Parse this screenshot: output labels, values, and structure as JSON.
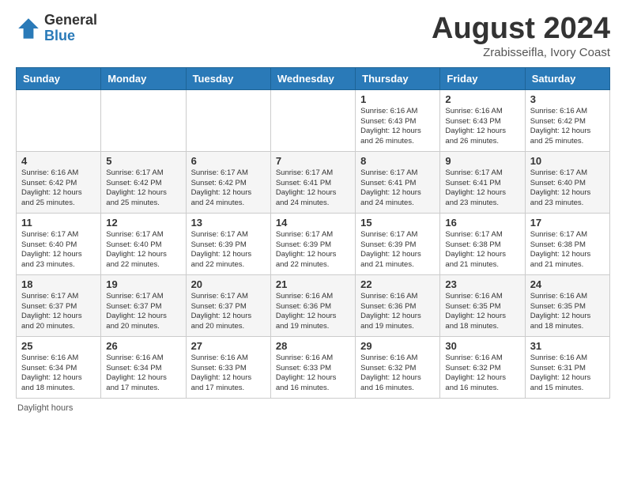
{
  "logo": {
    "general": "General",
    "blue": "Blue"
  },
  "title": "August 2024",
  "subtitle": "Zrabisseifla, Ivory Coast",
  "headers": [
    "Sunday",
    "Monday",
    "Tuesday",
    "Wednesday",
    "Thursday",
    "Friday",
    "Saturday"
  ],
  "footer": "Daylight hours",
  "weeks": [
    [
      {
        "day": "",
        "info": ""
      },
      {
        "day": "",
        "info": ""
      },
      {
        "day": "",
        "info": ""
      },
      {
        "day": "",
        "info": ""
      },
      {
        "day": "1",
        "info": "Sunrise: 6:16 AM\nSunset: 6:43 PM\nDaylight: 12 hours\nand 26 minutes."
      },
      {
        "day": "2",
        "info": "Sunrise: 6:16 AM\nSunset: 6:43 PM\nDaylight: 12 hours\nand 26 minutes."
      },
      {
        "day": "3",
        "info": "Sunrise: 6:16 AM\nSunset: 6:42 PM\nDaylight: 12 hours\nand 25 minutes."
      }
    ],
    [
      {
        "day": "4",
        "info": "Sunrise: 6:16 AM\nSunset: 6:42 PM\nDaylight: 12 hours\nand 25 minutes."
      },
      {
        "day": "5",
        "info": "Sunrise: 6:17 AM\nSunset: 6:42 PM\nDaylight: 12 hours\nand 25 minutes."
      },
      {
        "day": "6",
        "info": "Sunrise: 6:17 AM\nSunset: 6:42 PM\nDaylight: 12 hours\nand 24 minutes."
      },
      {
        "day": "7",
        "info": "Sunrise: 6:17 AM\nSunset: 6:41 PM\nDaylight: 12 hours\nand 24 minutes."
      },
      {
        "day": "8",
        "info": "Sunrise: 6:17 AM\nSunset: 6:41 PM\nDaylight: 12 hours\nand 24 minutes."
      },
      {
        "day": "9",
        "info": "Sunrise: 6:17 AM\nSunset: 6:41 PM\nDaylight: 12 hours\nand 23 minutes."
      },
      {
        "day": "10",
        "info": "Sunrise: 6:17 AM\nSunset: 6:40 PM\nDaylight: 12 hours\nand 23 minutes."
      }
    ],
    [
      {
        "day": "11",
        "info": "Sunrise: 6:17 AM\nSunset: 6:40 PM\nDaylight: 12 hours\nand 23 minutes."
      },
      {
        "day": "12",
        "info": "Sunrise: 6:17 AM\nSunset: 6:40 PM\nDaylight: 12 hours\nand 22 minutes."
      },
      {
        "day": "13",
        "info": "Sunrise: 6:17 AM\nSunset: 6:39 PM\nDaylight: 12 hours\nand 22 minutes."
      },
      {
        "day": "14",
        "info": "Sunrise: 6:17 AM\nSunset: 6:39 PM\nDaylight: 12 hours\nand 22 minutes."
      },
      {
        "day": "15",
        "info": "Sunrise: 6:17 AM\nSunset: 6:39 PM\nDaylight: 12 hours\nand 21 minutes."
      },
      {
        "day": "16",
        "info": "Sunrise: 6:17 AM\nSunset: 6:38 PM\nDaylight: 12 hours\nand 21 minutes."
      },
      {
        "day": "17",
        "info": "Sunrise: 6:17 AM\nSunset: 6:38 PM\nDaylight: 12 hours\nand 21 minutes."
      }
    ],
    [
      {
        "day": "18",
        "info": "Sunrise: 6:17 AM\nSunset: 6:37 PM\nDaylight: 12 hours\nand 20 minutes."
      },
      {
        "day": "19",
        "info": "Sunrise: 6:17 AM\nSunset: 6:37 PM\nDaylight: 12 hours\nand 20 minutes."
      },
      {
        "day": "20",
        "info": "Sunrise: 6:17 AM\nSunset: 6:37 PM\nDaylight: 12 hours\nand 20 minutes."
      },
      {
        "day": "21",
        "info": "Sunrise: 6:16 AM\nSunset: 6:36 PM\nDaylight: 12 hours\nand 19 minutes."
      },
      {
        "day": "22",
        "info": "Sunrise: 6:16 AM\nSunset: 6:36 PM\nDaylight: 12 hours\nand 19 minutes."
      },
      {
        "day": "23",
        "info": "Sunrise: 6:16 AM\nSunset: 6:35 PM\nDaylight: 12 hours\nand 18 minutes."
      },
      {
        "day": "24",
        "info": "Sunrise: 6:16 AM\nSunset: 6:35 PM\nDaylight: 12 hours\nand 18 minutes."
      }
    ],
    [
      {
        "day": "25",
        "info": "Sunrise: 6:16 AM\nSunset: 6:34 PM\nDaylight: 12 hours\nand 18 minutes."
      },
      {
        "day": "26",
        "info": "Sunrise: 6:16 AM\nSunset: 6:34 PM\nDaylight: 12 hours\nand 17 minutes."
      },
      {
        "day": "27",
        "info": "Sunrise: 6:16 AM\nSunset: 6:33 PM\nDaylight: 12 hours\nand 17 minutes."
      },
      {
        "day": "28",
        "info": "Sunrise: 6:16 AM\nSunset: 6:33 PM\nDaylight: 12 hours\nand 16 minutes."
      },
      {
        "day": "29",
        "info": "Sunrise: 6:16 AM\nSunset: 6:32 PM\nDaylight: 12 hours\nand 16 minutes."
      },
      {
        "day": "30",
        "info": "Sunrise: 6:16 AM\nSunset: 6:32 PM\nDaylight: 12 hours\nand 16 minutes."
      },
      {
        "day": "31",
        "info": "Sunrise: 6:16 AM\nSunset: 6:31 PM\nDaylight: 12 hours\nand 15 minutes."
      }
    ]
  ]
}
